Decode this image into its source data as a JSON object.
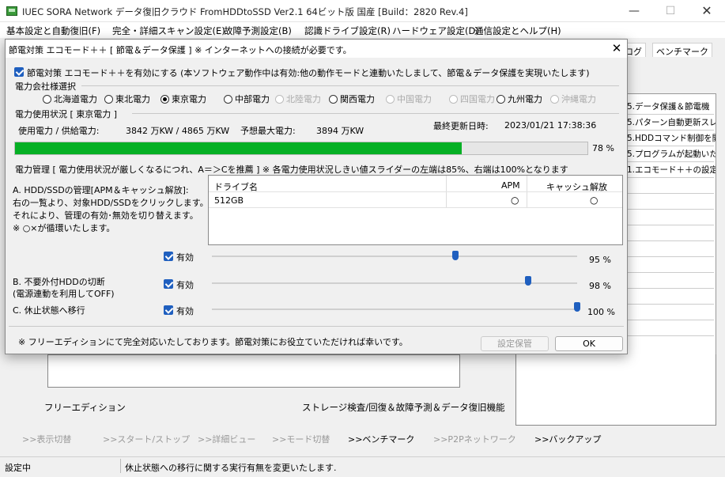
{
  "app": {
    "title": "IUEC SORA Network データ復旧クラウド FromHDDtoSSD Ver2.1 64ビット版 国産 [Build：2820 Rev.4]",
    "window_controls": {
      "minimize": "—",
      "maximize": "☐",
      "close": "✕"
    }
  },
  "menubar": [
    "基本設定と自動復旧(F)",
    "完全・詳細スキャン設定(E)",
    "故障予測設定(B)",
    "認識ドライブ設定(R)",
    "ハードウェア設定(D)",
    "通信設定とヘルプ(H)"
  ],
  "background": {
    "tabs": [
      "ログ",
      "ベンチマーク"
    ],
    "list_lines": [
      "5.データ保護＆節電機",
      "5.パターン自動更新スレ",
      "5.HDDコマンド制御を開",
      "5.プログラムが起動いた",
      "1.エコモード＋＋の設定"
    ],
    "edition_label": "フリーエディション",
    "feature_label": "ストレージ検査/回復＆故障予測＆データ復旧機能"
  },
  "navbar": [
    {
      "label": ">>表示切替",
      "active": false
    },
    {
      "label": ">>スタート/ストップ",
      "active": false
    },
    {
      "label": ">>詳細ビュー",
      "active": false
    },
    {
      "label": ">>モード切替",
      "active": false
    },
    {
      "label": ">>ベンチマーク",
      "active": true
    },
    {
      "label": ">>P2Pネットワーク",
      "active": false
    },
    {
      "label": ">>バックアップ",
      "active": true
    }
  ],
  "status": {
    "left": "設定中",
    "message": "休止状態への移行に関する実行有無を変更いたします."
  },
  "dialog": {
    "title": "節電対策 エコモード＋＋ [ 節電＆データ保護 ] ※ インターネットへの接続が必要です。",
    "close": "✕",
    "eco_checkbox_label": "節電対策 エコモード＋＋を有効にする (本ソフトウェア動作中は有効:他の動作モードと連動いたしまして、節電＆データ保護を実現いたします)",
    "company_group_label": "電力会社様選択",
    "companies": [
      {
        "label": "北海道電力",
        "selected": false,
        "enabled": true
      },
      {
        "label": "東北電力",
        "selected": false,
        "enabled": true
      },
      {
        "label": "東京電力",
        "selected": true,
        "enabled": true
      },
      {
        "label": "中部電力",
        "selected": false,
        "enabled": true
      },
      {
        "label": "北陸電力",
        "selected": false,
        "enabled": false
      },
      {
        "label": "関西電力",
        "selected": false,
        "enabled": true
      },
      {
        "label": "中国電力",
        "selected": false,
        "enabled": false
      },
      {
        "label": "四国電力",
        "selected": false,
        "enabled": false
      },
      {
        "label": "九州電力",
        "selected": false,
        "enabled": true
      },
      {
        "label": "沖縄電力",
        "selected": false,
        "enabled": false
      }
    ],
    "usage": {
      "group_label": "電力使用状況 [ 東京電力 ]",
      "usage_label": "使用電力 / 供給電力:",
      "usage_value": "3842 万KW / 4865 万KW",
      "peak_label": "予想最大電力:",
      "peak_value": "3894 万KW",
      "updated_label": "最終更新日時:",
      "updated_value": "2023/01/21 17:38:36",
      "percent_label": "78 %",
      "percent_fraction": 0.78
    },
    "management": {
      "group_label": "電力管理 [ 電力使用状況が厳しくなるにつれ、A＝＞Cを推薦 ] ※ 各電力使用状況しきい値スライダーの左端は85%、右端は100%となります",
      "a_desc": [
        "A. HDD/SSDの管理[APM＆キャッシュ解放]:",
        "右の一覧より、対象HDD/SSDをクリックします。",
        "それにより、管理の有効･無効を切り替えます。",
        "※ ○×が循環いたします。"
      ],
      "table": {
        "headers": [
          "ドライブ名",
          "APM",
          "キャッシュ解放"
        ],
        "rows": [
          {
            "drive": "512GB",
            "apm": "○",
            "cache": "○"
          }
        ]
      },
      "a_enabled_label": "有効",
      "a_percent": "95 %",
      "a_value": 95,
      "b_desc": [
        "B. 不要外付HDDの切断",
        "(電源連動を利用してOFF)"
      ],
      "b_enabled_label": "有効",
      "b_percent": "98 %",
      "b_value": 98,
      "c_desc": "C. 休止状態へ移行",
      "c_enabled_label": "有効",
      "c_percent": "100 %",
      "c_value": 100
    },
    "footer_note": "※ フリーエディションにて完全対応いたしております。節電対策にお役立ていただければ幸いです。",
    "save_button": "設定保管",
    "ok_button": "OK"
  }
}
